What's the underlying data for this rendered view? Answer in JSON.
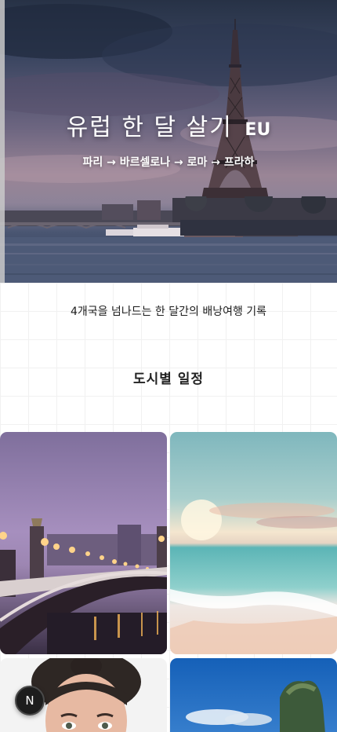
{
  "hero": {
    "title": "유럽 한 달 살기",
    "badge": "EU",
    "route": "파리 → 바르셀로나 → 로마 → 프라하",
    "image_icon": "eiffel-tower-icon"
  },
  "intro": {
    "subtitle": "4개국을 넘나드는 한 달간의 배낭여행 기록"
  },
  "section": {
    "title": "도시별 일정"
  },
  "cards": [
    {
      "image": "paris-bridge-photo"
    },
    {
      "image": "beach-sunset-photo"
    },
    {
      "image": "portrait-photo"
    },
    {
      "image": "tropical-island-photo"
    }
  ],
  "floating_button": {
    "label": "N"
  },
  "colors": {
    "background": "#ffffff",
    "grid": "#f1f1f1",
    "text": "#1b1b1b",
    "button": "#1d1d1d"
  }
}
